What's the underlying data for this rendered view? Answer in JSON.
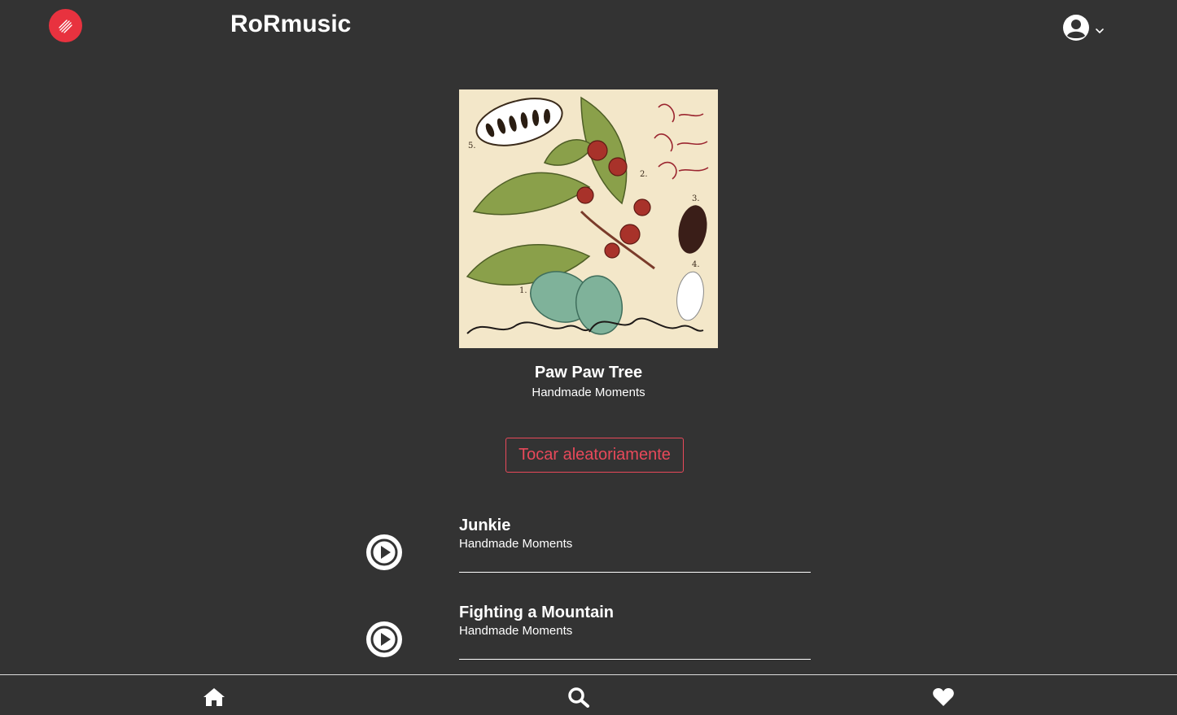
{
  "header": {
    "app_title": "RoRmusic",
    "logo_icon": "music-waves-icon",
    "user_icon": "user-circle-icon",
    "menu_icon": "chevron-down-icon"
  },
  "album": {
    "title": "Paw Paw Tree",
    "artist": "Handmade Moments",
    "cover": {
      "numbers": [
        "1.",
        "2.",
        "3.",
        "4.",
        "5."
      ]
    }
  },
  "shuffle_label": "Tocar aleatoriamente",
  "tracks": [
    {
      "name": "Junkie",
      "artist": "Handmade Moments"
    },
    {
      "name": "Fighting a Mountain",
      "artist": "Handmade Moments"
    }
  ],
  "bottom_nav": [
    {
      "icon": "home-icon"
    },
    {
      "icon": "search-icon"
    },
    {
      "icon": "heart-icon"
    }
  ],
  "colors": {
    "background": "#333333",
    "accent": "#e8495a",
    "logo": "#e8323f",
    "text": "#ffffff"
  }
}
